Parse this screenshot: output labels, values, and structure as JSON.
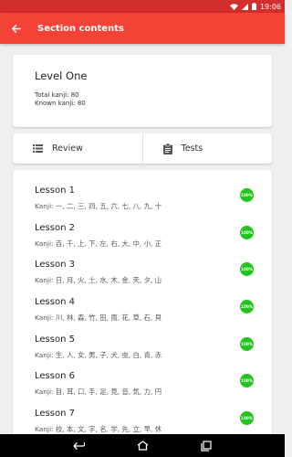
{
  "status_bar": {
    "time": "19:06",
    "icons": [
      "wifi-icon",
      "signal-icon",
      "battery-icon"
    ]
  },
  "app_bar": {
    "title": "Section contents",
    "back_icon": "arrow-back-icon",
    "background": "#f44336"
  },
  "level": {
    "title": "Level One",
    "total_kanji": "Total kanji:  80",
    "known_kanji": "Known kanji: 80"
  },
  "actions": {
    "review": {
      "label": "Review",
      "icon": "list-icon"
    },
    "tests": {
      "label": "Tests",
      "icon": "clipboard-icon"
    }
  },
  "lessons": [
    {
      "title": "Lesson 1",
      "kanji": "Kanji: 一, 二, 三, 四, 五, 六, 七, 八, 九, 十",
      "progress": "100%"
    },
    {
      "title": "Lesson 2",
      "kanji": "Kanji: 百, 千, 上, 下, 左, 右, 大, 中, 小, 正",
      "progress": "100%"
    },
    {
      "title": "Lesson 3",
      "kanji": "Kanji: 日, 月, 火, 土, 水, 木, 金, 天, 夕, 山",
      "progress": "100%"
    },
    {
      "title": "Lesson 4",
      "kanji": "Kanji: 川, 林, 森, 竹, 田, 雨, 花, 草, 石, 貝",
      "progress": "100%"
    },
    {
      "title": "Lesson 5",
      "kanji": "Kanji: 生, 人, 女, 男, 子, 犬, 虫, 白, 青, 赤",
      "progress": "100%"
    },
    {
      "title": "Lesson 6",
      "kanji": "Kanji: 目, 耳, 口, 手, 足, 見, 音, 気, 力, 円",
      "progress": "100%"
    },
    {
      "title": "Lesson 7",
      "kanji": "Kanji: 校, 本, 文, 字, 名, 学, 先, 立, 早, 休",
      "progress": "100%"
    }
  ],
  "progress_color": "#22c51e",
  "nav_bar": {
    "icons": [
      "back-nav-icon",
      "home-nav-icon",
      "recents-nav-icon"
    ]
  }
}
